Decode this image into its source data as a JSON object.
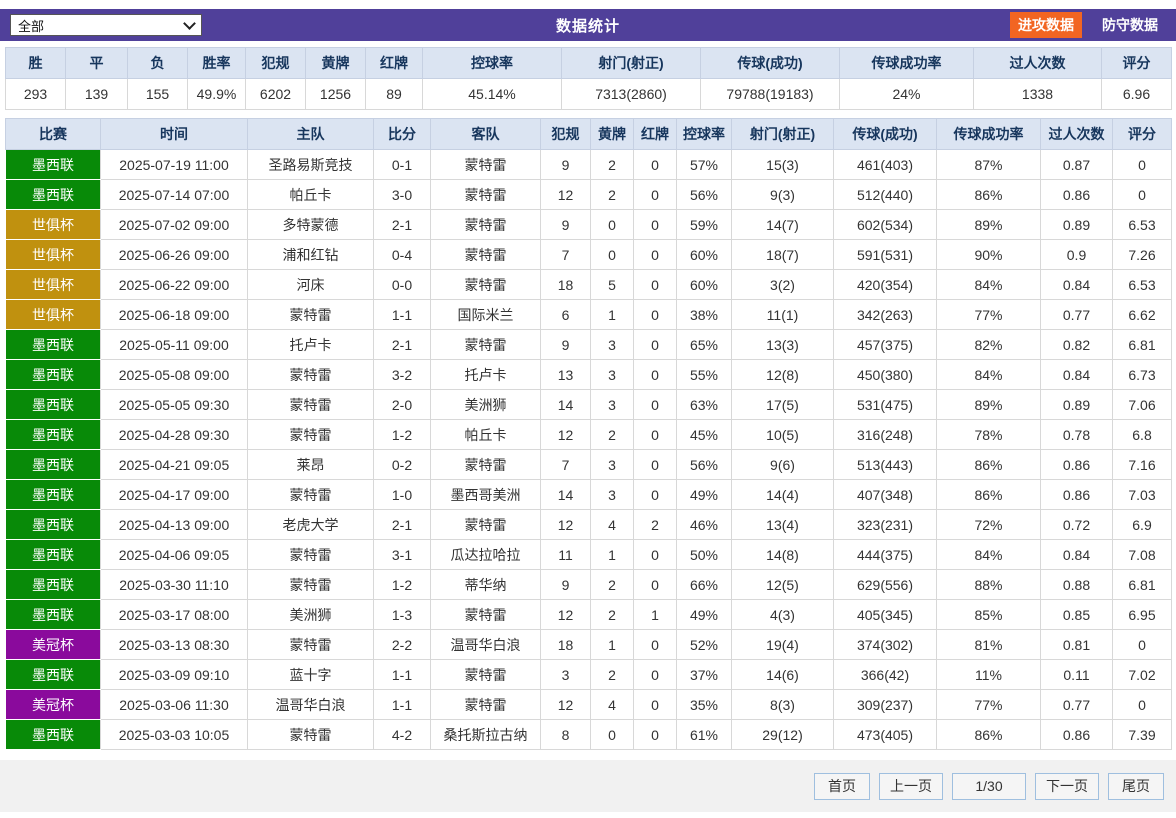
{
  "topbar": {
    "filter_value": "全部",
    "title": "数据统计",
    "attack_tab": "进攻数据",
    "defense_tab": "防守数据"
  },
  "colors": {
    "topbar_bg": "#50409A",
    "attack_tab_bg": "#F26522",
    "header_bg": "#DBE4F2",
    "header_text": "#17365D",
    "league": {
      "green": "#088A08",
      "gold": "#C0910F",
      "purple": "#8A0A9C"
    }
  },
  "summary": {
    "headers": [
      "胜",
      "平",
      "负",
      "胜率",
      "犯规",
      "黄牌",
      "红牌",
      "控球率",
      "射门(射正)",
      "传球(成功)",
      "传球成功率",
      "过人次数",
      "评分"
    ],
    "values": [
      "293",
      "139",
      "155",
      "49.9%",
      "6202",
      "1256",
      "89",
      "45.14%",
      "7313(2860)",
      "79788(19183)",
      "24%",
      "1338",
      "6.96"
    ]
  },
  "matches": {
    "headers": [
      "比赛",
      "时间",
      "主队",
      "比分",
      "客队",
      "犯规",
      "黄牌",
      "红牌",
      "控球率",
      "射门(射正)",
      "传球(成功)",
      "传球成功率",
      "过人次数",
      "评分"
    ],
    "rows": [
      {
        "league_color": "green",
        "cols": [
          "墨西联",
          "2025-07-19 11:00",
          "圣路易斯竞技",
          "0-1",
          "蒙特雷",
          "9",
          "2",
          "0",
          "57%",
          "15(3)",
          "461(403)",
          "87%",
          "0.87",
          "0"
        ]
      },
      {
        "league_color": "green",
        "cols": [
          "墨西联",
          "2025-07-14 07:00",
          "帕丘卡",
          "3-0",
          "蒙特雷",
          "12",
          "2",
          "0",
          "56%",
          "9(3)",
          "512(440)",
          "86%",
          "0.86",
          "0"
        ]
      },
      {
        "league_color": "gold",
        "cols": [
          "世俱杯",
          "2025-07-02 09:00",
          "多特蒙德",
          "2-1",
          "蒙特雷",
          "9",
          "0",
          "0",
          "59%",
          "14(7)",
          "602(534)",
          "89%",
          "0.89",
          "6.53"
        ]
      },
      {
        "league_color": "gold",
        "cols": [
          "世俱杯",
          "2025-06-26 09:00",
          "浦和红钻",
          "0-4",
          "蒙特雷",
          "7",
          "0",
          "0",
          "60%",
          "18(7)",
          "591(531)",
          "90%",
          "0.9",
          "7.26"
        ]
      },
      {
        "league_color": "gold",
        "cols": [
          "世俱杯",
          "2025-06-22 09:00",
          "河床",
          "0-0",
          "蒙特雷",
          "18",
          "5",
          "0",
          "60%",
          "3(2)",
          "420(354)",
          "84%",
          "0.84",
          "6.53"
        ]
      },
      {
        "league_color": "gold",
        "cols": [
          "世俱杯",
          "2025-06-18 09:00",
          "蒙特雷",
          "1-1",
          "国际米兰",
          "6",
          "1",
          "0",
          "38%",
          "11(1)",
          "342(263)",
          "77%",
          "0.77",
          "6.62"
        ]
      },
      {
        "league_color": "green",
        "cols": [
          "墨西联",
          "2025-05-11 09:00",
          "托卢卡",
          "2-1",
          "蒙特雷",
          "9",
          "3",
          "0",
          "65%",
          "13(3)",
          "457(375)",
          "82%",
          "0.82",
          "6.81"
        ]
      },
      {
        "league_color": "green",
        "cols": [
          "墨西联",
          "2025-05-08 09:00",
          "蒙特雷",
          "3-2",
          "托卢卡",
          "13",
          "3",
          "0",
          "55%",
          "12(8)",
          "450(380)",
          "84%",
          "0.84",
          "6.73"
        ]
      },
      {
        "league_color": "green",
        "cols": [
          "墨西联",
          "2025-05-05 09:30",
          "蒙特雷",
          "2-0",
          "美洲狮",
          "14",
          "3",
          "0",
          "63%",
          "17(5)",
          "531(475)",
          "89%",
          "0.89",
          "7.06"
        ]
      },
      {
        "league_color": "green",
        "cols": [
          "墨西联",
          "2025-04-28 09:30",
          "蒙特雷",
          "1-2",
          "帕丘卡",
          "12",
          "2",
          "0",
          "45%",
          "10(5)",
          "316(248)",
          "78%",
          "0.78",
          "6.8"
        ]
      },
      {
        "league_color": "green",
        "cols": [
          "墨西联",
          "2025-04-21 09:05",
          "莱昂",
          "0-2",
          "蒙特雷",
          "7",
          "3",
          "0",
          "56%",
          "9(6)",
          "513(443)",
          "86%",
          "0.86",
          "7.16"
        ]
      },
      {
        "league_color": "green",
        "cols": [
          "墨西联",
          "2025-04-17 09:00",
          "蒙特雷",
          "1-0",
          "墨西哥美洲",
          "14",
          "3",
          "0",
          "49%",
          "14(4)",
          "407(348)",
          "86%",
          "0.86",
          "7.03"
        ]
      },
      {
        "league_color": "green",
        "cols": [
          "墨西联",
          "2025-04-13 09:00",
          "老虎大学",
          "2-1",
          "蒙特雷",
          "12",
          "4",
          "2",
          "46%",
          "13(4)",
          "323(231)",
          "72%",
          "0.72",
          "6.9"
        ]
      },
      {
        "league_color": "green",
        "cols": [
          "墨西联",
          "2025-04-06 09:05",
          "蒙特雷",
          "3-1",
          "瓜达拉哈拉",
          "11",
          "1",
          "0",
          "50%",
          "14(8)",
          "444(375)",
          "84%",
          "0.84",
          "7.08"
        ]
      },
      {
        "league_color": "green",
        "cols": [
          "墨西联",
          "2025-03-30 11:10",
          "蒙特雷",
          "1-2",
          "蒂华纳",
          "9",
          "2",
          "0",
          "66%",
          "12(5)",
          "629(556)",
          "88%",
          "0.88",
          "6.81"
        ]
      },
      {
        "league_color": "green",
        "cols": [
          "墨西联",
          "2025-03-17 08:00",
          "美洲狮",
          "1-3",
          "蒙特雷",
          "12",
          "2",
          "1",
          "49%",
          "4(3)",
          "405(345)",
          "85%",
          "0.85",
          "6.95"
        ]
      },
      {
        "league_color": "purple",
        "cols": [
          "美冠杯",
          "2025-03-13 08:30",
          "蒙特雷",
          "2-2",
          "温哥华白浪",
          "18",
          "1",
          "0",
          "52%",
          "19(4)",
          "374(302)",
          "81%",
          "0.81",
          "0"
        ]
      },
      {
        "league_color": "green",
        "cols": [
          "墨西联",
          "2025-03-09 09:10",
          "蓝十字",
          "1-1",
          "蒙特雷",
          "3",
          "2",
          "0",
          "37%",
          "14(6)",
          "366(42)",
          "11%",
          "0.11",
          "7.02"
        ]
      },
      {
        "league_color": "purple",
        "cols": [
          "美冠杯",
          "2025-03-06 11:30",
          "温哥华白浪",
          "1-1",
          "蒙特雷",
          "12",
          "4",
          "0",
          "35%",
          "8(3)",
          "309(237)",
          "77%",
          "0.77",
          "0"
        ]
      },
      {
        "league_color": "green",
        "cols": [
          "墨西联",
          "2025-03-03 10:05",
          "蒙特雷",
          "4-2",
          "桑托斯拉古纳",
          "8",
          "0",
          "0",
          "61%",
          "29(12)",
          "473(405)",
          "86%",
          "0.86",
          "7.39"
        ]
      }
    ]
  },
  "pagination": {
    "first": "首页",
    "prev": "上一页",
    "page": "1/30",
    "next": "下一页",
    "last": "尾页"
  }
}
